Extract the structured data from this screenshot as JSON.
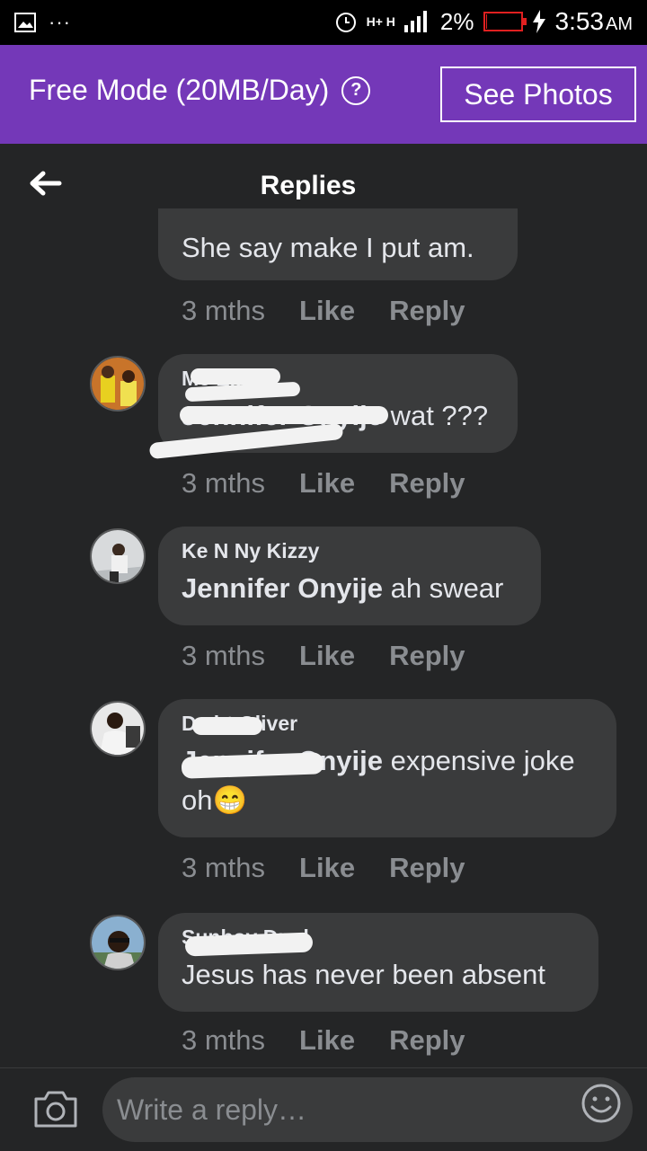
{
  "status_bar": {
    "signal": "H+ H",
    "battery": "2%",
    "battery_level": 0.02,
    "time": "3:53",
    "ampm": "AM"
  },
  "promo": {
    "mode_text": "Free Mode (20MB/Day)",
    "see_photos": "See Photos"
  },
  "header": {
    "title": "Replies"
  },
  "comments": [
    {
      "text": "She say make I put am.",
      "meta": {
        "time": "3 mths",
        "like": "Like",
        "reply": "Reply"
      }
    },
    {
      "author": "Mc E...",
      "mention": "Jennifer Onyije",
      "text": " wat ???",
      "meta": {
        "time": "3 mths",
        "like": "Like",
        "reply": "Reply"
      }
    },
    {
      "author": "Ke N Ny Kizzy",
      "mention": "Jennifer Onyije",
      "text": " ah swear",
      "meta": {
        "time": "3 mths",
        "like": "Like",
        "reply": "Reply"
      }
    },
    {
      "author": "D...ht Oliver",
      "mention": "Jennifer Onyije",
      "text": " expensive joke oh",
      "emoji": "😁",
      "meta": {
        "time": "3 mths",
        "like": "Like",
        "reply": "Reply"
      }
    },
    {
      "author": "Sunboy Dmd",
      "text": "Jesus has never been absent",
      "meta": {
        "time": "3 mths",
        "like": "Like",
        "reply": "Reply"
      }
    }
  ],
  "composer": {
    "placeholder": "Write a reply…"
  },
  "icons": [
    "gallery-icon",
    "more-icon",
    "alarm-icon",
    "signal-icon",
    "battery-icon",
    "charging-icon",
    "help-icon",
    "back-arrow-icon",
    "camera-icon",
    "emoji-icon"
  ]
}
